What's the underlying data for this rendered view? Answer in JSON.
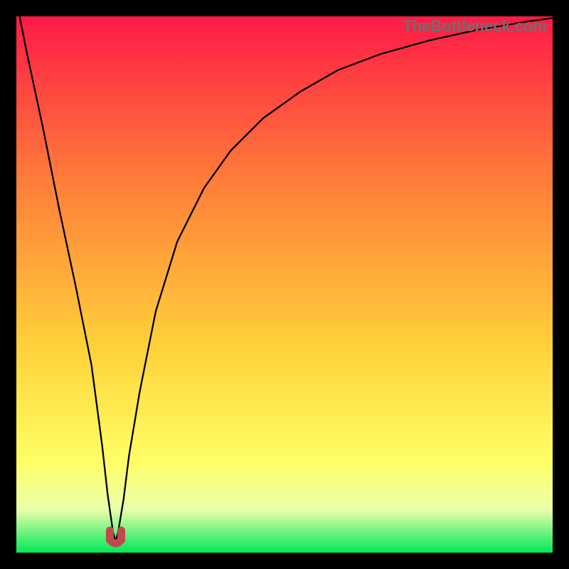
{
  "watermark": "TheBottleneck.com",
  "colors": {
    "frame": "#000000",
    "gradient_top": "#ff1a46",
    "gradient_mid1": "#ff7b3a",
    "gradient_mid2": "#ffd23a",
    "gradient_low": "#ffff66",
    "gradient_band_pale": "#eaffaa",
    "gradient_bottom": "#00e85a",
    "curve": "#000000",
    "dip_marker": "#c1494b"
  },
  "chart_data": {
    "type": "line",
    "title": "",
    "xlabel": "",
    "ylabel": "",
    "xlim": [
      0,
      100
    ],
    "ylim": [
      0,
      100
    ],
    "series": [
      {
        "name": "bottleneck-curve",
        "x": [
          0,
          2,
          5,
          8,
          11,
          14,
          16,
          17,
          18,
          18.5,
          19,
          20,
          21,
          23,
          26,
          30,
          35,
          40,
          46,
          53,
          60,
          68,
          77,
          86,
          95,
          100
        ],
        "y": [
          103,
          93,
          79,
          64,
          50,
          35,
          20,
          11,
          4,
          2,
          4,
          10,
          18,
          30,
          45,
          58,
          68,
          75,
          81,
          86,
          90,
          93,
          95.5,
          97.5,
          99,
          99.7
        ]
      }
    ],
    "annotations": [
      {
        "name": "dip-marker",
        "x": 18.5,
        "y": 2,
        "shape": "U",
        "color": "#c1494b"
      }
    ],
    "grid": false,
    "legend": false
  }
}
